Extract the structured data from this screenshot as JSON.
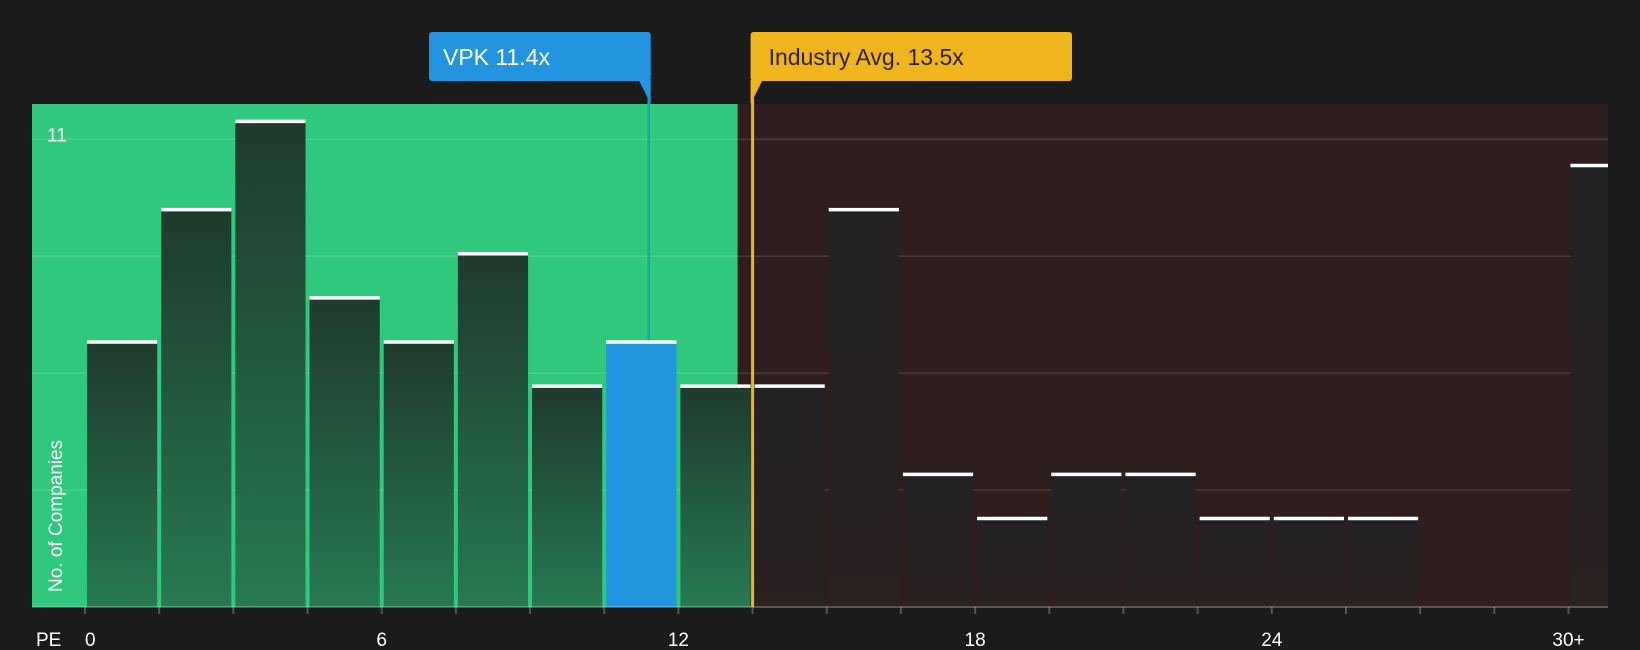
{
  "chart_data": {
    "type": "bar",
    "title": "",
    "xlabel": "PE",
    "ylabel": "No. of Companies",
    "ylim": [
      0,
      11.4
    ],
    "y_ticks": [
      11
    ],
    "x_ticks": [
      {
        "value": 0,
        "label": "0"
      },
      {
        "value": 6,
        "label": "6"
      },
      {
        "value": 12,
        "label": "12"
      },
      {
        "value": 18,
        "label": "18"
      },
      {
        "value": 24,
        "label": "24"
      },
      {
        "value": 30,
        "label": "30+"
      }
    ],
    "bins": [
      {
        "x0": 0,
        "x1": 1.5,
        "count": 6
      },
      {
        "x0": 1.5,
        "x1": 3,
        "count": 9
      },
      {
        "x0": 3,
        "x1": 4.5,
        "count": 11
      },
      {
        "x0": 4.5,
        "x1": 6,
        "count": 7
      },
      {
        "x0": 6,
        "x1": 7.5,
        "count": 6
      },
      {
        "x0": 7.5,
        "x1": 9,
        "count": 8
      },
      {
        "x0": 9,
        "x1": 10.5,
        "count": 5
      },
      {
        "x0": 10.5,
        "x1": 12,
        "count": 6,
        "highlight": true
      },
      {
        "x0": 12,
        "x1": 13.5,
        "count": 5
      },
      {
        "x0": 13.5,
        "x1": 15,
        "count": 5
      },
      {
        "x0": 15,
        "x1": 16.5,
        "count": 9
      },
      {
        "x0": 16.5,
        "x1": 18,
        "count": 3
      },
      {
        "x0": 18,
        "x1": 19.5,
        "count": 2
      },
      {
        "x0": 19.5,
        "x1": 21,
        "count": 3
      },
      {
        "x0": 21,
        "x1": 22.5,
        "count": 3
      },
      {
        "x0": 22.5,
        "x1": 24,
        "count": 2
      },
      {
        "x0": 24,
        "x1": 25.5,
        "count": 2
      },
      {
        "x0": 25.5,
        "x1": 27,
        "count": 2
      },
      {
        "x0": 27,
        "x1": 28.5,
        "count": 0
      },
      {
        "x0": 28.5,
        "x1": 30,
        "count": 0
      },
      {
        "x0": 30,
        "x1": 31.5,
        "count": 10
      }
    ],
    "subject": {
      "label": "VPK 11.4x",
      "value": 11.4,
      "color": "#2394df"
    },
    "industry": {
      "label": "Industry Avg. 13.5x",
      "value": 13.5,
      "color": "#f0b41c"
    },
    "zones": [
      {
        "name": "undervalued",
        "from": 0,
        "to": 13.2,
        "color": "#2fc87d"
      },
      {
        "name": "overvalued",
        "from": 13.2,
        "to": 30.8,
        "color": "#2e1e1f"
      }
    ],
    "grid": true,
    "legend": "none"
  }
}
